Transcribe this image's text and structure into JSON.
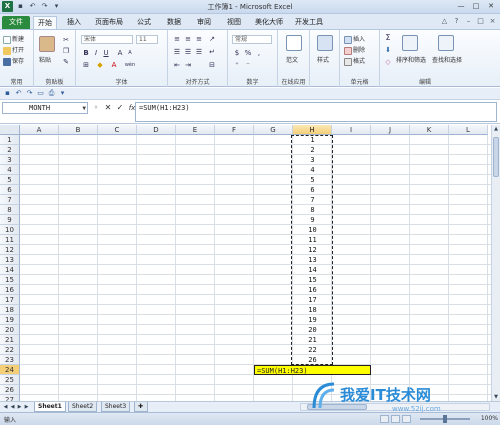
{
  "window": {
    "title": "工作簿1 - Microsoft Excel",
    "app_icon_label": "X",
    "controls": [
      "—",
      "□",
      "✕"
    ]
  },
  "qat_top_icons": [
    "save-icon",
    "undo-icon",
    "redo-icon",
    "customize-icon"
  ],
  "ribbon_tabs": [
    {
      "label": "文件"
    },
    {
      "label": "开始"
    },
    {
      "label": "插入"
    },
    {
      "label": "页面布局"
    },
    {
      "label": "公式"
    },
    {
      "label": "数据"
    },
    {
      "label": "审阅"
    },
    {
      "label": "视图"
    },
    {
      "label": "美化大师"
    },
    {
      "label": "开发工具"
    }
  ],
  "ribbon": {
    "groups": {
      "common": {
        "label": "常用",
        "new": "新建",
        "open": "打开",
        "save": "保存"
      },
      "clipboard": {
        "label": "剪贴板",
        "paste": "粘贴"
      },
      "font": {
        "label": "字体",
        "font_name": "宋体",
        "font_size": "11",
        "bold": "B",
        "italic": "I",
        "underline": "U",
        "grow": "A",
        "shrink": "A",
        "wen": "wén"
      },
      "alignment": {
        "label": "对齐方式"
      },
      "number": {
        "label": "数字",
        "format": "常规",
        "percent": "%",
        "comma": ",",
        "currency": "$"
      },
      "online": {
        "label": "在线应用",
        "template": "范文"
      },
      "styles": {
        "label": "",
        "style": "样式"
      },
      "cells": {
        "label": "单元格",
        "insert": "插入",
        "delete": "删除",
        "format": "格式"
      },
      "editing": {
        "label": "编辑",
        "sort": "排序和筛选",
        "find": "查找和选择",
        "sigma": "Σ"
      }
    }
  },
  "formula_bar": {
    "name_box": "MONTH",
    "cancel": "✕",
    "enter": "✓",
    "fx": "fx",
    "formula": "=SUM(H1:H23)"
  },
  "grid": {
    "columns": [
      "A",
      "B",
      "C",
      "D",
      "E",
      "F",
      "G",
      "H",
      "I",
      "J",
      "K",
      "L"
    ],
    "rows": [
      "1",
      "2",
      "3",
      "4",
      "5",
      "6",
      "7",
      "8",
      "9",
      "10",
      "11",
      "12",
      "13",
      "14",
      "15",
      "16",
      "17",
      "18",
      "19",
      "20",
      "21",
      "22",
      "23",
      "24",
      "25",
      "26",
      "27"
    ],
    "column_h_values": [
      "1",
      "2",
      "3",
      "4",
      "5",
      "6",
      "7",
      "8",
      "9",
      "10",
      "11",
      "12",
      "13",
      "14",
      "15",
      "16",
      "17",
      "18",
      "19",
      "20",
      "21",
      "22",
      "26"
    ],
    "active_cell_text": "=SUM(H1:H23)",
    "selected_column": "H",
    "selected_row": "24"
  },
  "sheets": [
    "Sheet1",
    "Sheet2",
    "Sheet3"
  ],
  "status": {
    "mode": "输入",
    "zoom": "100%"
  },
  "colors": {
    "file_tab": "#2a8a3e",
    "highlight": "#ffff00",
    "header_selected": "#f5cf78"
  },
  "watermark": {
    "text": "我爱IT技术网",
    "url": "www.52ij.com"
  }
}
